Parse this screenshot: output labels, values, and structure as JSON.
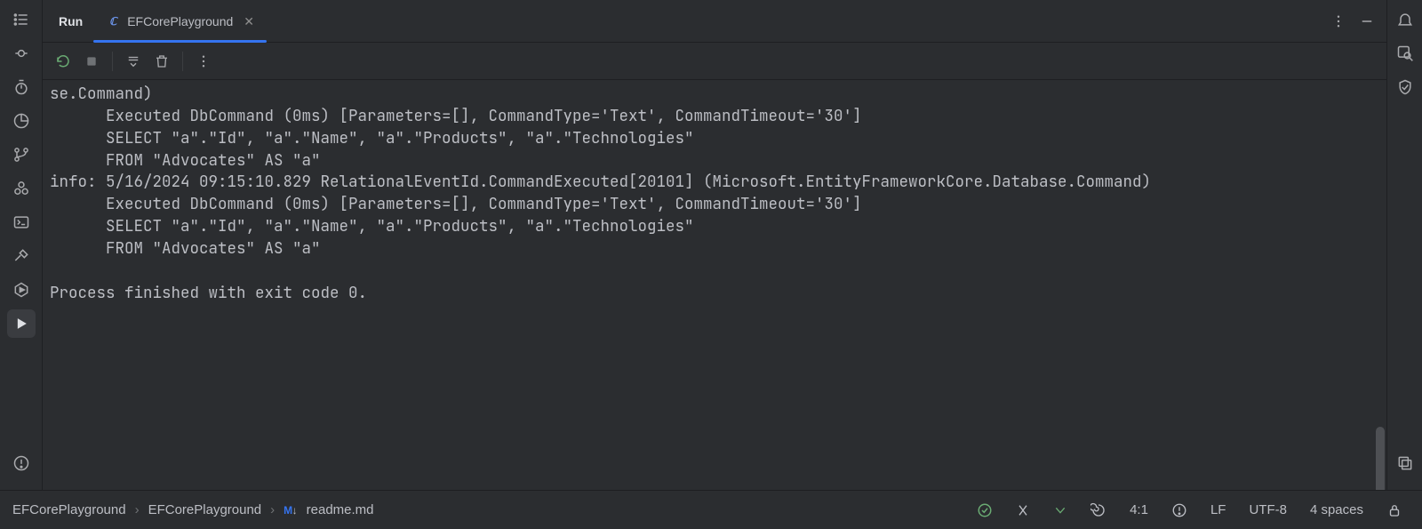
{
  "header": {
    "run_label": "Run",
    "tab_label": "EFCorePlayground"
  },
  "console": {
    "text": "se.Command)\n      Executed DbCommand (0ms) [Parameters=[], CommandType='Text', CommandTimeout='30']\n      SELECT \"a\".\"Id\", \"a\".\"Name\", \"a\".\"Products\", \"a\".\"Technologies\"\n      FROM \"Advocates\" AS \"a\"\ninfo: 5/16/2024 09:15:10.829 RelationalEventId.CommandExecuted[20101] (Microsoft.EntityFrameworkCore.Database.Command)\n      Executed DbCommand (0ms) [Parameters=[], CommandType='Text', CommandTimeout='30']\n      SELECT \"a\".\"Id\", \"a\".\"Name\", \"a\".\"Products\", \"a\".\"Technologies\"\n      FROM \"Advocates\" AS \"a\"\n\nProcess finished with exit code 0."
  },
  "breadcrumbs": {
    "seg0": "EFCorePlayground",
    "seg1": "EFCorePlayground",
    "file": "readme.md"
  },
  "status": {
    "cursor": "4:1",
    "line_sep": "LF",
    "encoding": "UTF-8",
    "indent": "4 spaces"
  }
}
